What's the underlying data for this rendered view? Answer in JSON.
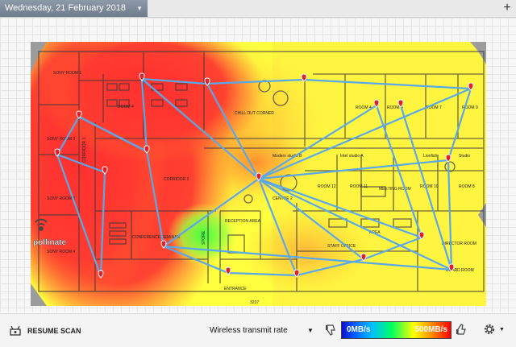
{
  "topbar": {
    "date_tab": "Wednesday, 21 February 2018",
    "add_tab_icon": "plus-icon"
  },
  "floorplan": {
    "rooms": {
      "sony_room_1": "SONY ROOM 1",
      "sony_room_2": "SONY ROOM 2",
      "sony_room_3": "SONY ROOM 3",
      "sony_room_4": "SONY ROOM 4",
      "room_4a": "ROOM 4",
      "chill_out": "CHILL OUT CORNER",
      "room_4b": "ROOM 4",
      "room_5": "ROOM 5",
      "room_7": "ROOM 7",
      "room_9": "ROOM 9",
      "corridor_1": "CORRIDOR 1",
      "corridor_2": "CORRIDOR 2",
      "modern_studio_b": "Modern studio B",
      "intel_studio_a": "Intel studio A",
      "lionfish": "Lionfish",
      "studio": "Studio",
      "room_12": "ROOM 12",
      "room_11": "ROOM 11",
      "meeting_room": "MEETING ROOM",
      "room_10": "ROOM 10",
      "room_8": "ROOM 8",
      "centre_2": "CENTRE 2",
      "reception": "RECEPTION AREA",
      "area": "AREA",
      "director_room": "DIRECTOR ROOM",
      "conference": "CONFERENCE SEMINAR",
      "store": "STORE",
      "staff_office": "STAFF OFFICE",
      "board_room": "BOARD ROOM",
      "entrance": "ENTRANCE",
      "dimension": "3237"
    },
    "access_point_label": "pollinate",
    "colors": {
      "hot": "#ff2020",
      "warm": "#ff9a30",
      "mid": "#ffff30",
      "cool": "#30ff60",
      "link": "#59a9e8",
      "pin": "#e0202a"
    }
  },
  "bottombar": {
    "resume_label": "RESUME SCAN",
    "resume_icon": "radio-scan-icon",
    "metric_select": "Wireless transmit rate",
    "legend_min": "0MB/s",
    "legend_max": "500MB/s",
    "thumb_down_icon": "thumb-down-icon",
    "thumb_up_icon": "thumb-up-icon",
    "settings_icon": "gear-icon"
  }
}
